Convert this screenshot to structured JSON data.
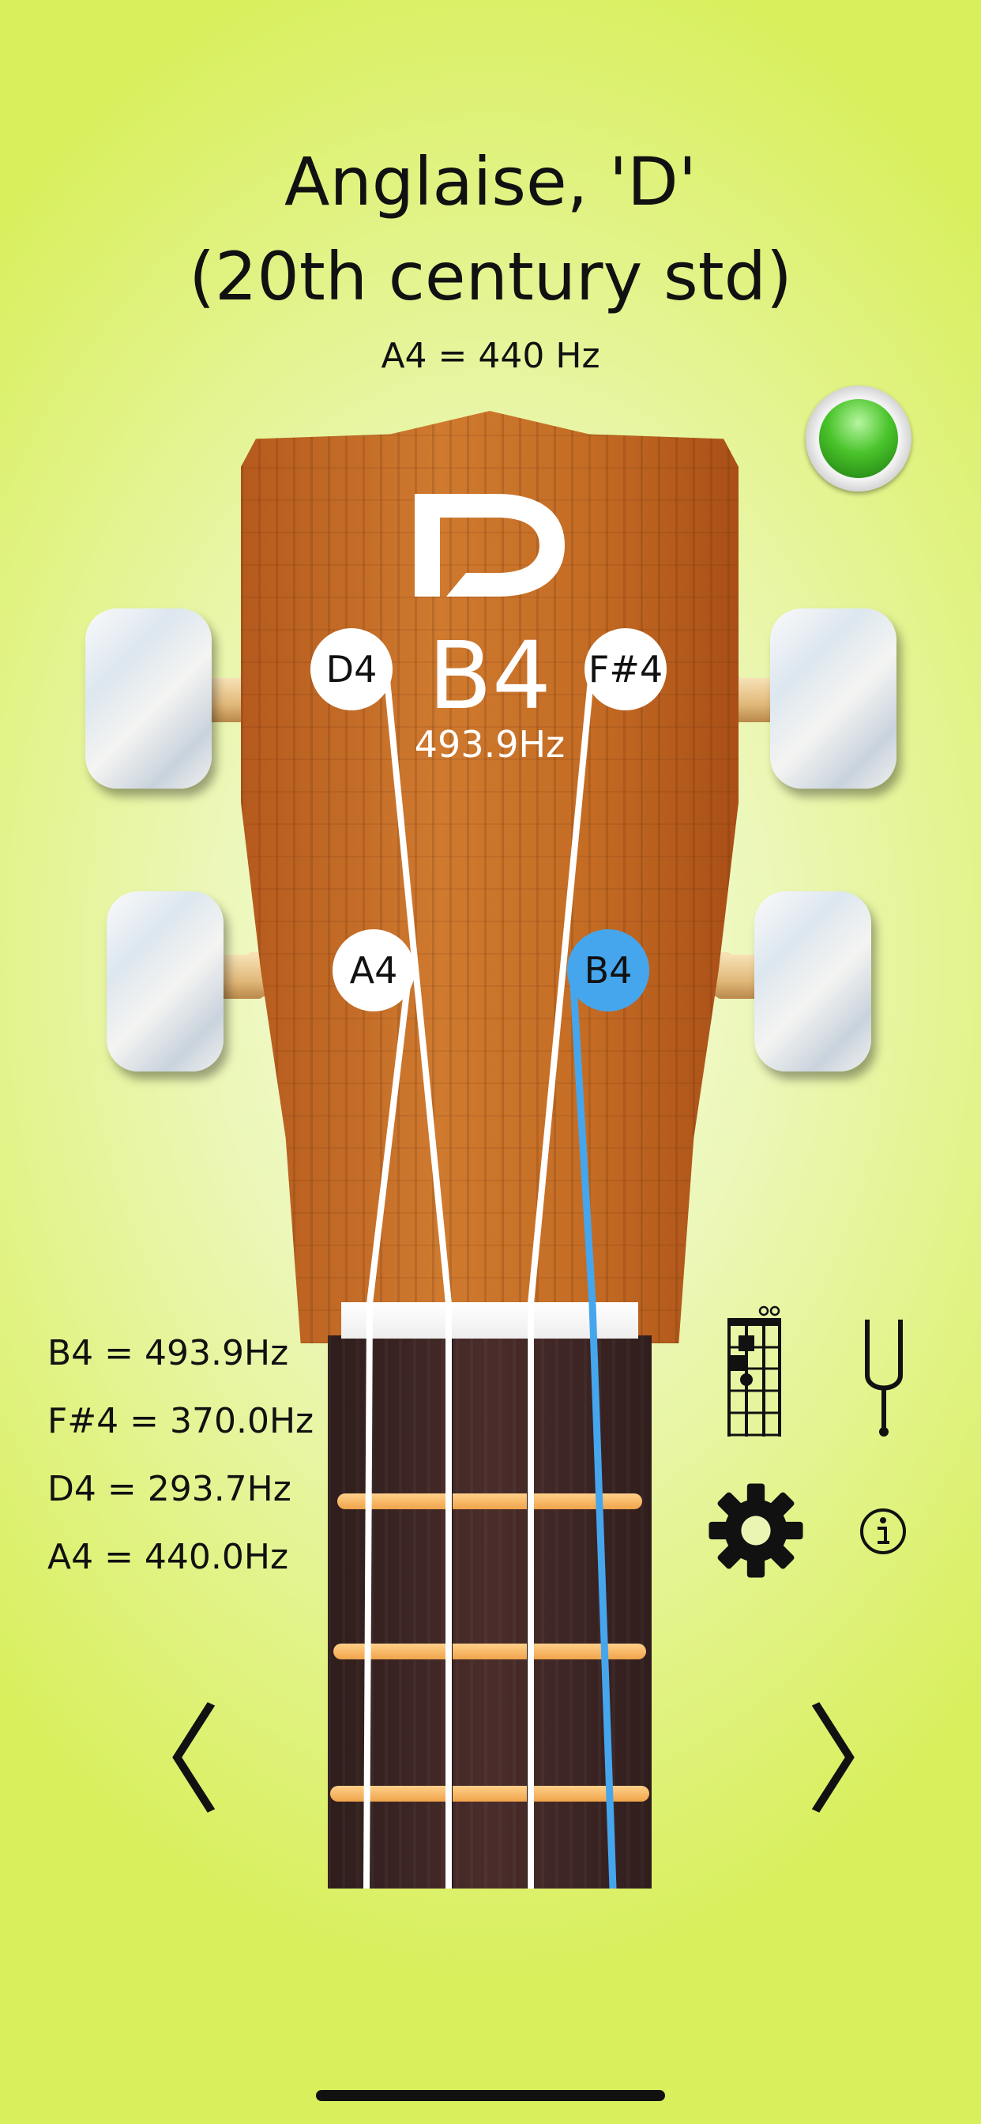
{
  "header": {
    "title_line1": "Anglaise, 'D'",
    "title_line2": "(20th century std)",
    "reference": "A4 = 440 Hz"
  },
  "brand": {
    "logo_letter": "D"
  },
  "tuner": {
    "current_note": "B4",
    "current_freq": "493.9Hz",
    "status": "in-tune (green light)"
  },
  "strings": [
    {
      "note": "D4",
      "position": "top-left",
      "active": false
    },
    {
      "note": "F#4",
      "position": "top-right",
      "active": false
    },
    {
      "note": "A4",
      "position": "bottom-left",
      "active": false
    },
    {
      "note": "B4",
      "position": "bottom-right",
      "active": true
    }
  ],
  "frequencies": [
    {
      "label": "B4 = 493.9Hz"
    },
    {
      "label": "F#4 = 370.0Hz"
    },
    {
      "label": "D4 = 293.7Hz"
    },
    {
      "label": "A4 = 440.0Hz"
    }
  ],
  "tools": {
    "chord_chart_icon": "chord-chart-icon",
    "tuning_fork_icon": "tuning-fork-icon",
    "settings_icon": "gear-icon",
    "info_icon": "info-icon"
  },
  "nav": {
    "prev": "〈",
    "next": "〉"
  },
  "colors": {
    "active_string": "#45a6ee",
    "led": "#3fbf26",
    "accent_bg": "#d9ef5c"
  }
}
